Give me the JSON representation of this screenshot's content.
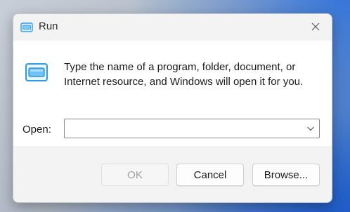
{
  "window": {
    "title": "Run",
    "close_label": "✕"
  },
  "dialog": {
    "description": "Type the name of a program, folder, document, or Internet resource, and Windows will open it for you.",
    "open_label": "Open:",
    "open_value": "",
    "open_placeholder": ""
  },
  "buttons": {
    "ok": "OK",
    "cancel": "Cancel",
    "browse": "Browse..."
  },
  "icons": {
    "title_icon": "run-icon",
    "big_icon": "run-icon",
    "close_icon": "close-icon",
    "dropdown_icon": "chevron-down-icon"
  },
  "colors": {
    "accent": "#2f9be6",
    "disabled_text": "#a0a0a0"
  },
  "state": {
    "ok_enabled": false
  }
}
